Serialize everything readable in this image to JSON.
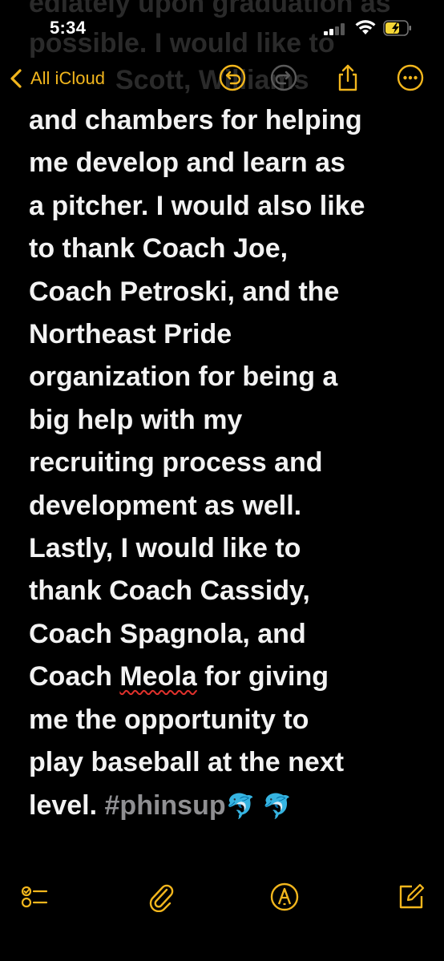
{
  "status_bar": {
    "time": "5:34"
  },
  "ghost_text": {
    "line1": "ediately upon graduation as",
    "line2": "possible.  I would like to",
    "line3": "Scott, Williams"
  },
  "toolbar": {
    "back_label": "All iCloud"
  },
  "note": {
    "lines": [
      "and chambers for helping",
      "me develop and learn as",
      "a pitcher.  I would also like",
      "to thank Coach Joe,",
      "Coach Petroski, and the",
      "Northeast Pride",
      "organization for being a",
      "big help with my",
      "recruiting process and",
      "development as well.",
      "Lastly, I would like to",
      "thank Coach Cassidy,",
      "Coach Spagnola, and"
    ],
    "line14_pre": "Coach ",
    "line14_misspelled": "Meola",
    "line14_post": " for giving",
    "line15": "me the opportunity to",
    "line16": "play baseball at the next",
    "line17_pre": "level.  ",
    "hashtag": "#phinsup",
    "emoji": "🐬 🐬"
  },
  "colors": {
    "accent": "#f2b61d",
    "background": "#000000",
    "text": "#f2f2f2",
    "hashtag": "#8f8f92"
  },
  "icons": {
    "back": "chevron-left-icon",
    "undo": "undo-icon",
    "redo": "redo-icon",
    "share": "share-icon",
    "more": "more-icon",
    "checklist": "checklist-icon",
    "attachment": "paperclip-icon",
    "markup": "markup-pen-icon",
    "compose": "compose-icon"
  }
}
